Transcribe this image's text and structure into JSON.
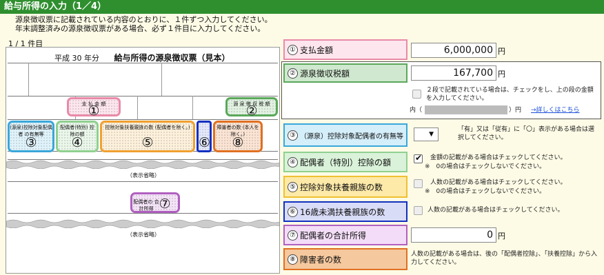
{
  "title": "給与所得の入力（1／4）",
  "intro": {
    "line1": "源泉徴収票に記載されている内容のとおりに、１件ずつ入力してください。",
    "line2": "年末調整済みの源泉徴収票がある場合、必ず１件目に入力してください。"
  },
  "counter": "1 / 1 件目",
  "slip": {
    "era": "平成 30 年分",
    "title": "給与所得の源泉徴収票（見本）",
    "omitted": "（表示省略）",
    "markers": [
      {
        "num": "①",
        "text": "支 払 金 額"
      },
      {
        "num": "②",
        "text": "源 泉 徴 収 税 額"
      },
      {
        "num": "③",
        "text": "(源泉)控除対象配偶者 の有無等"
      },
      {
        "num": "④",
        "text": "配偶者(特別) 控除の額"
      },
      {
        "num": "⑤",
        "text": "控除対象扶養親族の数 (配偶者を除く。)"
      },
      {
        "num": "⑥",
        "text": "16歳未満"
      },
      {
        "num": "⑧",
        "text": "障害者の数 (本人を除く。)"
      },
      {
        "num": "⑦",
        "text": "配偶者の 合計所得"
      }
    ]
  },
  "fields": {
    "f1": {
      "num": "①",
      "label": "支払金額",
      "value": "6,000,000",
      "unit": "円"
    },
    "f2": {
      "num": "②",
      "label": "源泉徴収税額",
      "value": "167,700",
      "unit": "円",
      "checkbox_text": "２段で記載されている場合は、チェックをし、上の段の金額を入力してください。",
      "inner_prefix": "内（",
      "inner_suffix": "）円",
      "link": "→詳しくはこちら"
    },
    "f3": {
      "num": "③",
      "label": "（源泉）控除対象配偶者の有無等",
      "select_value": "",
      "note": "「有」又は「従有」に「〇」表示がある場合は選択してください。"
    },
    "f4": {
      "num": "④",
      "label": "配偶者（特別）控除の額",
      "note1": "金額の記載がある場合はチェックしてください。",
      "note2": "※　0の場合はチェックしないでください。"
    },
    "f5": {
      "num": "⑤",
      "label": "控除対象扶養親族の数",
      "note1": "人数の記載がある場合はチェックしてください。",
      "note2": "※　0の場合はチェックしないでください。"
    },
    "f6": {
      "num": "⑥",
      "label": "16歳未満扶養親族の数",
      "note1": "人数の記載がある場合はチェックしてください。"
    },
    "f7": {
      "num": "⑦",
      "label": "配偶者の合計所得",
      "value": "0",
      "unit": "円"
    },
    "f8": {
      "num": "⑧",
      "label": "障害者の数",
      "note": "人数の記載がある場合は、後の「配偶者控除」、「扶養控除」から入力してください。"
    }
  },
  "colors": {
    "title_bar": "#2f8f2f",
    "pink": "#e98aa8",
    "green": "#5aa85a",
    "cyan": "#39a7d9",
    "lime": "#8fd08f",
    "orange": "#f0a030",
    "blue": "#1030c0",
    "dorange": "#e07020",
    "purple": "#b060c0"
  }
}
